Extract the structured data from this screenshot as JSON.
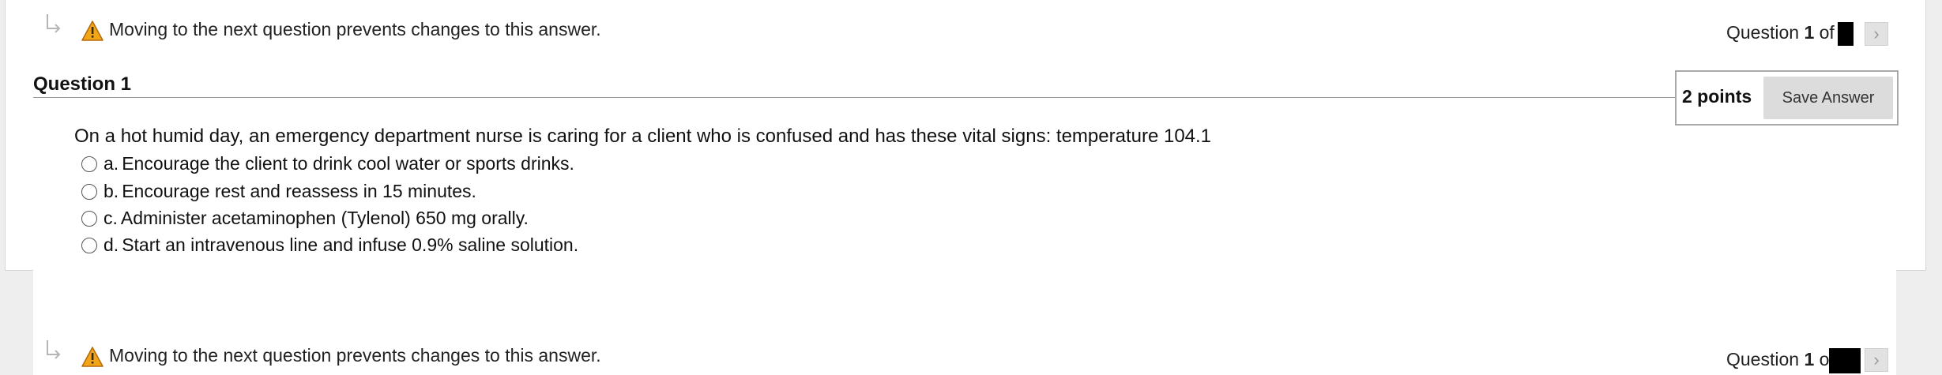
{
  "warning": {
    "message": "Moving to the next question prevents changes to this answer."
  },
  "counter": {
    "prefix": "Question ",
    "number": "1",
    "of_top": " of",
    "of_bottom": " o"
  },
  "question": {
    "title": "Question 1",
    "points": "2 points",
    "save_label": "Save Answer",
    "text": "On a hot humid day, an emergency department nurse is caring for a client who is confused and has these vital signs: temperature 104.1",
    "answers": [
      {
        "letter": "a.",
        "text": "Encourage the client to drink cool water or sports drinks."
      },
      {
        "letter": "b.",
        "text": "Encourage rest and reassess in 15 minutes."
      },
      {
        "letter": "c.",
        "text": "Administer acetaminophen (Tylenol) 650 mg orally."
      },
      {
        "letter": "d.",
        "text": "Start an intravenous line and infuse 0.9% saline solution."
      }
    ]
  },
  "icons": {
    "next": "chevron-right-icon",
    "warning": "warning-triangle-icon",
    "arrow": "turn-arrow-icon"
  },
  "colors": {
    "warning_fill": "#f2a516",
    "panel_bg": "#ffffff",
    "page_bg": "#eeeeee",
    "button_bg": "#dcdcdc"
  }
}
